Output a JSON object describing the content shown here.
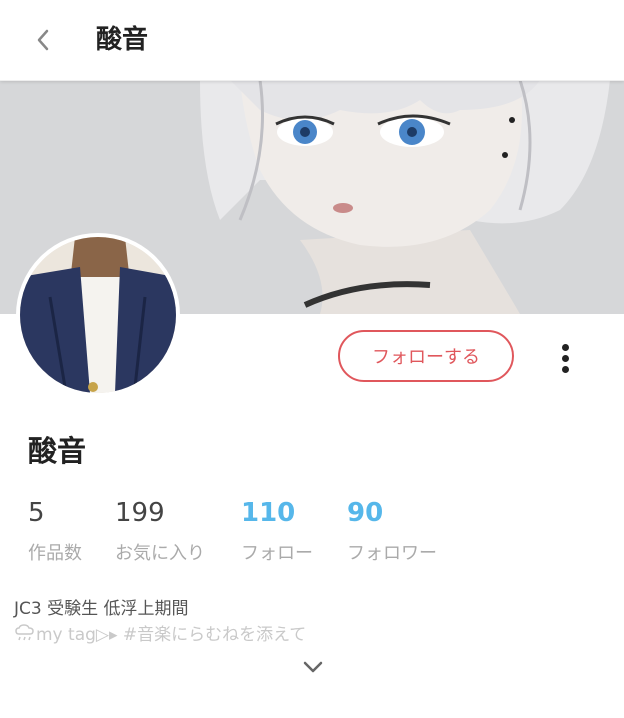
{
  "header": {
    "title": "酸音",
    "back_icon": "chevron-left-icon"
  },
  "profile": {
    "name": "酸音",
    "follow_label": "フォローする",
    "more_icon": "more-vertical-icon",
    "accent_color": "#e0575c"
  },
  "stats": [
    {
      "value": "5",
      "label": "作品数"
    },
    {
      "value": "199",
      "label": "お気に入り"
    },
    {
      "value": "110",
      "label": "フォロー"
    },
    {
      "value": "90",
      "label": "フォロワー"
    }
  ],
  "stats_accent_color": "#56b7ea",
  "bio": {
    "line1": "JC3 受験生 低浮上期間",
    "line2": "my tag▷▸ #音楽にらむねを添えて",
    "line2_icon": "cloud-rain-icon"
  },
  "expand_icon": "chevron-down-icon"
}
